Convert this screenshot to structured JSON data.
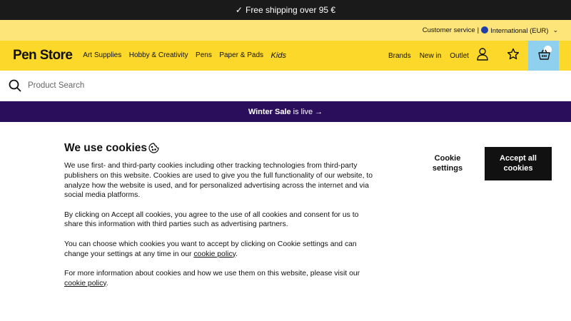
{
  "topbar": {
    "check_icon": "✓",
    "text": "Free shipping over 95 €"
  },
  "service": {
    "customer_service": "Customer service",
    "separator": "|",
    "region": "International (EUR)",
    "chevron": "⌄"
  },
  "header": {
    "logo": "Pen Store",
    "nav": [
      "Art Supplies",
      "Hobby & Creativity",
      "Pens",
      "Paper & Pads",
      "Kids"
    ],
    "right_nav": [
      "Brands",
      "New in",
      "Outlet"
    ],
    "icons": [
      "user-icon",
      "star-icon",
      "basket-icon"
    ],
    "colors": {
      "bar": "#fcd82b",
      "cart_bg": "#8fd0ee"
    }
  },
  "search": {
    "placeholder": "Product Search"
  },
  "sale": {
    "bold": "Winter Sale",
    "rest": "is live →",
    "bg": "#2a0e5c"
  },
  "cookie": {
    "title": "We use cookies",
    "p1": "We use first- and third-party cookies including other tracking technologies from third-party publishers on this website. Cookies are used to give you the full functionality of our website, to analyze how the website is used, and for personalized advertising across the internet and via social media platforms.",
    "p2": "By clicking on Accept all cookies, you agree to the use of all cookies and consent for us to share this information with third parties such as advertising partners.",
    "p3_pre": "You can choose which cookies you want to accept by clicking on Cookie settings and can change your settings at any time in our ",
    "p3_link": "cookie policy",
    "p3_post": ".",
    "p4_pre": "For more information about cookies and how we use them on this website, please visit our ",
    "p4_link": "cookie policy",
    "p4_post": ".",
    "settings_btn": "Cookie settings",
    "accept_btn": "Accept all cookies"
  }
}
